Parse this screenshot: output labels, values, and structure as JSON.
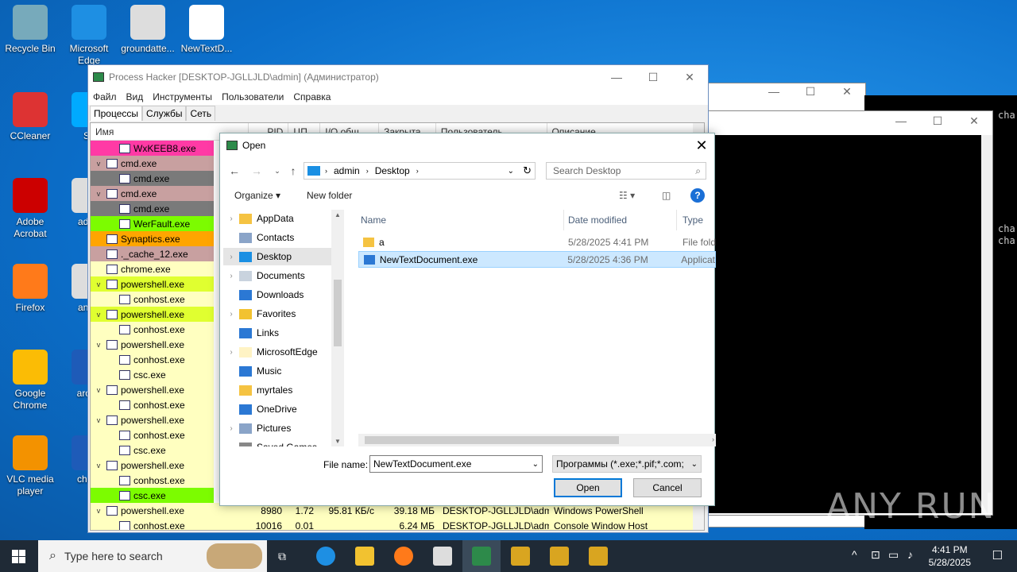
{
  "desktop": {
    "icons": [
      {
        "label": "Recycle Bin"
      },
      {
        "label": "Microsoft Edge"
      },
      {
        "label": "groundatte..."
      },
      {
        "label": "NewTextD..."
      },
      {
        "label": "CCleaner"
      },
      {
        "label": "Sk"
      },
      {
        "label": "Adobe Acrobat"
      },
      {
        "label": "advic"
      },
      {
        "label": "Firefox"
      },
      {
        "label": "answ"
      },
      {
        "label": "Google Chrome"
      },
      {
        "label": "aroun"
      },
      {
        "label": "VLC media player"
      },
      {
        "label": "charg"
      }
    ]
  },
  "console_right": {
    "lines": [
      "cha",
      "cha",
      "cha"
    ]
  },
  "process_hacker": {
    "title": "Process Hacker [DESKTOP-JGLLJLD\\admin] (Администратор)",
    "menu": [
      "Файл",
      "Вид",
      "Инструменты",
      "Пользователи",
      "Справка"
    ],
    "tabs": [
      "Процессы",
      "Службы",
      "Сеть"
    ],
    "columns": [
      "Имя",
      "PID",
      "ЦП",
      "I/O обш...",
      "Закрыта...",
      "Пользователь",
      "Описание"
    ],
    "rows": [
      {
        "name": "WxKEEB8.exe",
        "indent": 1,
        "tw": "",
        "bg": "#ff3aa5"
      },
      {
        "name": "cmd.exe",
        "indent": 0,
        "tw": "v",
        "bg": "#c8a0a0"
      },
      {
        "name": "cmd.exe",
        "indent": 1,
        "tw": "",
        "bg": "#7a7a7a"
      },
      {
        "name": "cmd.exe",
        "indent": 0,
        "tw": "v",
        "bg": "#c8a0a0"
      },
      {
        "name": "cmd.exe",
        "indent": 1,
        "tw": "",
        "bg": "#7a7a7a"
      },
      {
        "name": "WerFault.exe",
        "indent": 1,
        "tw": "",
        "bg": "#7cfc00"
      },
      {
        "name": "Synaptics.exe",
        "indent": 0,
        "tw": "",
        "bg": "#ffa500"
      },
      {
        "name": "._cache_12.exe",
        "indent": 0,
        "tw": "",
        "bg": "#c8a0a0"
      },
      {
        "name": "chrome.exe",
        "indent": 0,
        "tw": "",
        "bg": "#ffffc0"
      },
      {
        "name": "powershell.exe",
        "indent": 0,
        "tw": "v",
        "bg": "#e0ff30"
      },
      {
        "name": "conhost.exe",
        "indent": 1,
        "tw": "",
        "bg": "#ffffc0"
      },
      {
        "name": "powershell.exe",
        "indent": 0,
        "tw": "v",
        "bg": "#e0ff30"
      },
      {
        "name": "conhost.exe",
        "indent": 1,
        "tw": "",
        "bg": "#ffffc0"
      },
      {
        "name": "powershell.exe",
        "indent": 0,
        "tw": "v",
        "bg": "#ffffc0"
      },
      {
        "name": "conhost.exe",
        "indent": 1,
        "tw": "",
        "bg": "#ffffc0"
      },
      {
        "name": "csc.exe",
        "indent": 1,
        "tw": "",
        "bg": "#ffffc0"
      },
      {
        "name": "powershell.exe",
        "indent": 0,
        "tw": "v",
        "bg": "#ffffc0"
      },
      {
        "name": "conhost.exe",
        "indent": 1,
        "tw": "",
        "bg": "#ffffc0"
      },
      {
        "name": "powershell.exe",
        "indent": 0,
        "tw": "v",
        "bg": "#ffffc0"
      },
      {
        "name": "conhost.exe",
        "indent": 1,
        "tw": "",
        "bg": "#ffffc0"
      },
      {
        "name": "csc.exe",
        "indent": 1,
        "tw": "",
        "bg": "#ffffc0"
      },
      {
        "name": "powershell.exe",
        "indent": 0,
        "tw": "v",
        "bg": "#ffffc0"
      },
      {
        "name": "conhost.exe",
        "indent": 1,
        "tw": "",
        "bg": "#ffffc0"
      },
      {
        "name": "csc.exe",
        "indent": 1,
        "tw": "",
        "bg": "#7cfc00"
      },
      {
        "name": "powershell.exe",
        "indent": 0,
        "tw": "v",
        "bg": "#ffffc0",
        "pid": "8980",
        "cpu": "1.72",
        "io": "95.81 КБ/с",
        "mem": "39.18 МБ",
        "user": "DESKTOP-JGLLJLD\\admi",
        "desc": "Windows PowerShell"
      },
      {
        "name": "conhost.exe",
        "indent": 1,
        "tw": "",
        "bg": "#ffffc0",
        "pid": "10016",
        "cpu": "0.01",
        "io": "",
        "mem": "6.24 МБ",
        "user": "DESKTOP-JGLLJLD\\admi",
        "desc": "Console Window Host"
      }
    ]
  },
  "open_dialog": {
    "title": "Open",
    "path": [
      "admin",
      "Desktop"
    ],
    "search_placeholder": "Search Desktop",
    "organize": "Organize ▾",
    "new_folder": "New folder",
    "nav_items": [
      {
        "label": "AppData",
        "chev": true,
        "color": "#f5c342"
      },
      {
        "label": "Contacts",
        "chev": false,
        "color": "#8aa4c8"
      },
      {
        "label": "Desktop",
        "chev": true,
        "color": "#1a8fe3",
        "selected": true
      },
      {
        "label": "Documents",
        "chev": true,
        "color": "#c9d3de"
      },
      {
        "label": "Downloads",
        "chev": false,
        "color": "#2b78d4"
      },
      {
        "label": "Favorites",
        "chev": true,
        "color": "#f2c230"
      },
      {
        "label": "Links",
        "chev": false,
        "color": "#2b78d4"
      },
      {
        "label": "MicrosoftEdge",
        "chev": true,
        "color": "#fff3c4"
      },
      {
        "label": "Music",
        "chev": false,
        "color": "#2b78d4"
      },
      {
        "label": "myrtales",
        "chev": false,
        "color": "#f5c342"
      },
      {
        "label": "OneDrive",
        "chev": false,
        "color": "#2b78d4"
      },
      {
        "label": "Pictures",
        "chev": true,
        "color": "#8aa4c8"
      },
      {
        "label": "Saved Games",
        "chev": false,
        "color": "#888888"
      }
    ],
    "columns": [
      "Name",
      "Date modified",
      "Type"
    ],
    "files": [
      {
        "name": "a",
        "date": "5/28/2025 4:41 PM",
        "type": "File fold",
        "selected": false,
        "color": "#f5c342"
      },
      {
        "name": "NewTextDocument.exe",
        "date": "5/28/2025 4:36 PM",
        "type": "Applicat",
        "selected": true,
        "color": "#2b78d4"
      }
    ],
    "filename_label": "File name:",
    "filename_value": "NewTextDocument.exe",
    "filter_value": "Программы (*.exe;*.pif;*.com;",
    "open_label": "Open",
    "cancel_label": "Cancel"
  },
  "taskbar": {
    "search_placeholder": "Type here to search",
    "time": "4:41 PM",
    "date": "5/28/2025"
  },
  "watermark": "ANY RUN"
}
